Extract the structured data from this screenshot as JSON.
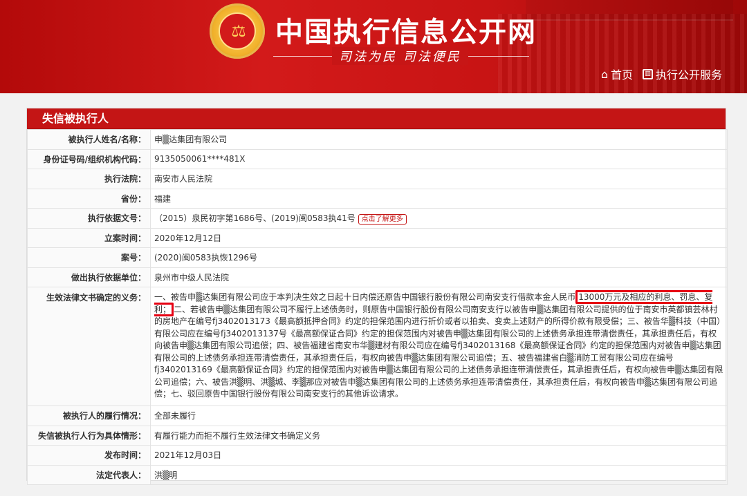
{
  "header": {
    "site_title": "中国执行信息公开网",
    "slogan": "司法为民  司法便民",
    "nav": [
      {
        "icon": "home-icon",
        "label": "首页"
      },
      {
        "icon": "chart-icon",
        "label": "执行公开服务"
      }
    ]
  },
  "panel": {
    "title": "失信被执行人",
    "more_label": "点击了解更多",
    "rows": [
      {
        "label": "被执行人姓名/名称：",
        "value": "申▒达集团有限公司"
      },
      {
        "label": "身份证号码/组织机构代码：",
        "value": "9135050061****481X"
      },
      {
        "label": "执行法院：",
        "value": "南安市人民法院"
      },
      {
        "label": "省份：",
        "value": "福建"
      },
      {
        "label": "执行依据文号：",
        "value": "（2015）泉民初字第1686号、(2019)闽0583执41号"
      },
      {
        "label": "立案时间：",
        "value": "2020年12月12日"
      },
      {
        "label": "案号：",
        "value": "(2020)闽0583执恢1296号"
      },
      {
        "label": "做出执行依据单位：",
        "value": "泉州市中级人民法院"
      },
      {
        "label": "生效法律文书确定的义务：",
        "value_pre": "一、被告申▒达集团有限公司应于本判决生效之日起十日内偿还原告中国银行股份有限公司南安支行借款本金人民币",
        "value_hl": "13000万元及相应的利息、罚息、复利；",
        "value_post": "二、若被告申▒达集团有限公司不履行上述债务时，则原告中国银行股份有限公司南安支行以被告申▒达集团有限公司提供的位于南安市英都镇芸林村的房地产在编号fj3402013173《最高额抵押合同》约定的担保范围内进行折价或者以拍卖、变卖上述财产的所得价款有限受偿；三、被告华▒科技（中国）有限公司应在编号fj3402013137号《最高额保证合同》约定的担保范围内对被告申▒达集团有限公司的上述债务承担连带清偿责任，其承担责任后，有权向被告申▒达集团有限公司追偿；四、被告福建省南安市华▒建材有限公司应在编号fj3402013168《最高额保证合同》约定的担保范围内对被告申▒达集团有限公司的上述债务承担连带清偿责任，其承担责任后，有权向被告申▒达集团有限公司追偿；五、被告福建省白▒消防工贸有限公司应在编号fj3402013169《最高额保证合同》约定的担保范围内对被告申▒达集团有限公司的上述债务承担连带清偿责任，其承担责任后，有权向被告申▒达集团有限公司追偿；六、被告洪▒明、洪▒城、李▒那应对被告申▒达集团有限公司的上述债务承担连带清偿责任，其承担责任后，有权向被告申▒达集团有限公司追偿；七、驳回原告中国银行股份有限公司南安支行的其他诉讼请求。"
      },
      {
        "label": "被执行人的履行情况：",
        "value": "全部未履行"
      },
      {
        "label": "失信被执行人行为具体情形：",
        "value": "有履行能力而拒不履行生效法律文书确定义务"
      },
      {
        "label": "发布时间：",
        "value": "2021年12月03日"
      },
      {
        "label": "法定代表人：",
        "value": "洪▒明"
      }
    ]
  },
  "colors": {
    "brand_red": "#c41515",
    "highlight_box": "#e60012"
  }
}
